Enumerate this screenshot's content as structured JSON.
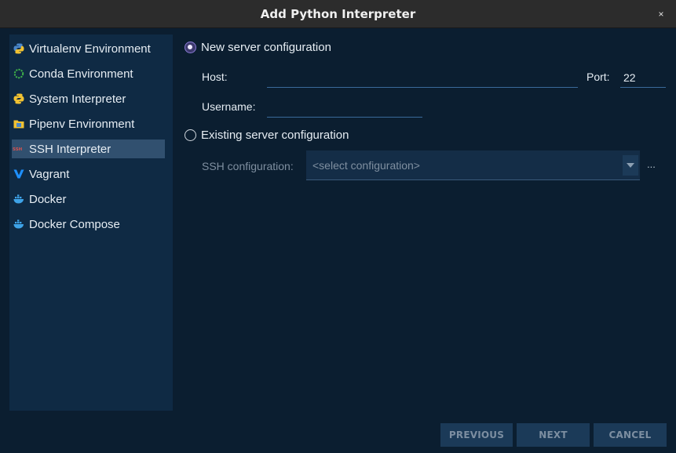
{
  "window": {
    "title": "Add Python Interpreter",
    "close_glyph": "×"
  },
  "sidebar": {
    "items": [
      {
        "label": "Virtualenv Environment",
        "icon": "python-icon",
        "selected": false
      },
      {
        "label": "Conda Environment",
        "icon": "conda-icon",
        "selected": false
      },
      {
        "label": "System Interpreter",
        "icon": "python-icon",
        "selected": false
      },
      {
        "label": "Pipenv Environment",
        "icon": "folder-icon",
        "selected": false
      },
      {
        "label": "SSH Interpreter",
        "icon": "ssh-icon",
        "selected": true
      },
      {
        "label": "Vagrant",
        "icon": "vagrant-icon",
        "selected": false
      },
      {
        "label": "Docker",
        "icon": "docker-icon",
        "selected": false
      },
      {
        "label": "Docker Compose",
        "icon": "docker-icon",
        "selected": false
      }
    ]
  },
  "form": {
    "new_server_label": "New server configuration",
    "new_server_selected": true,
    "host_label": "Host:",
    "host_value": "",
    "port_label": "Port:",
    "port_value": "22",
    "username_label": "Username:",
    "username_value": "",
    "existing_server_label": "Existing server configuration",
    "existing_server_selected": false,
    "ssh_config_label": "SSH configuration:",
    "ssh_config_selected": "<select configuration>",
    "ellipsis": "..."
  },
  "buttons": {
    "previous": "PREVIOUS",
    "next": "NEXT",
    "cancel": "CANCEL"
  },
  "colors": {
    "accent": "#8a7bd4",
    "selection": "#31506f",
    "background": "#0b1e30",
    "sidebar": "#0f2a44"
  }
}
